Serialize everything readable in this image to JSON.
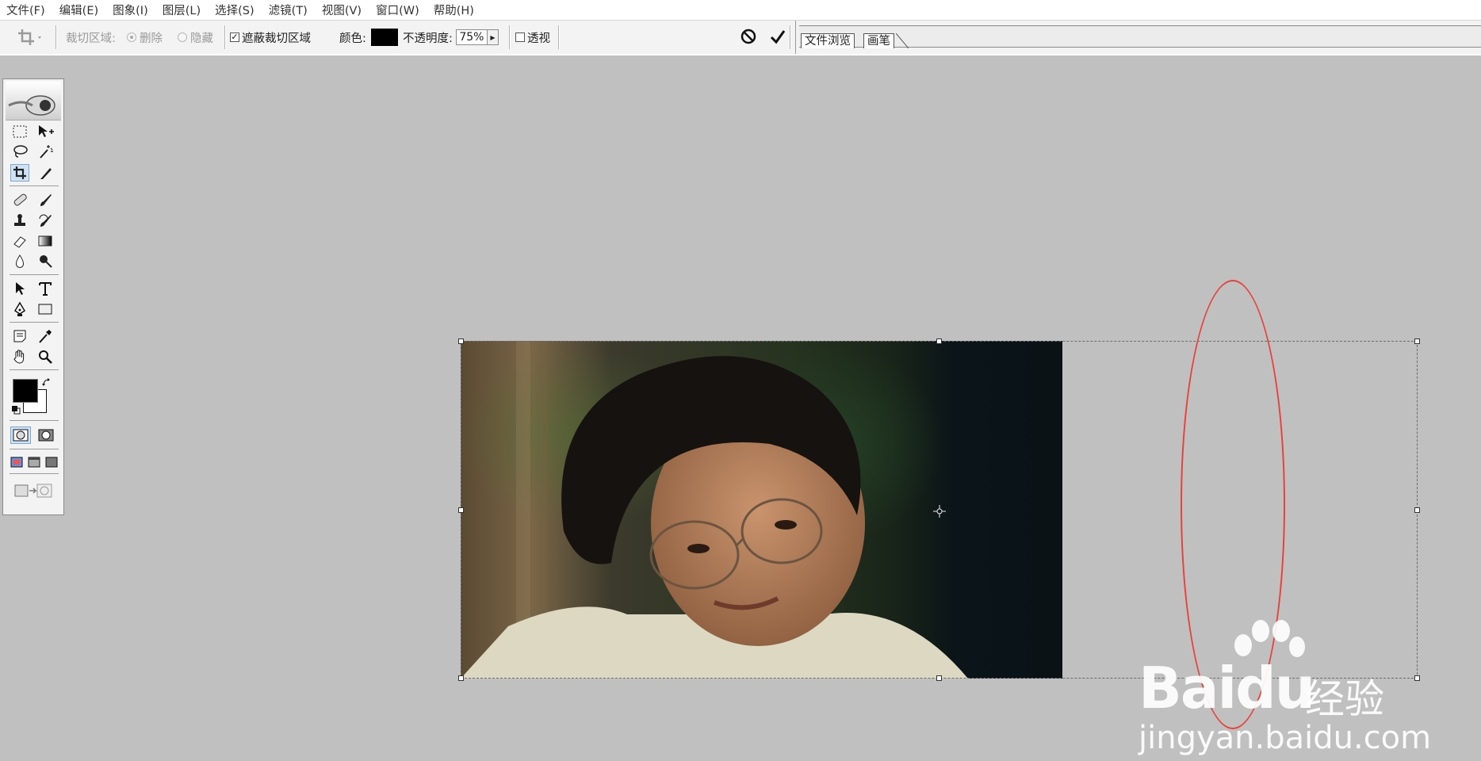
{
  "menubar": {
    "items": [
      "文件(F)",
      "编辑(E)",
      "图象(I)",
      "图层(L)",
      "选择(S)",
      "滤镜(T)",
      "视图(V)",
      "窗口(W)",
      "帮助(H)"
    ]
  },
  "options": {
    "crop_area_label": "裁切区域:",
    "delete_label": "删除",
    "hide_label": "隐藏",
    "shield_label": "遮蔽裁切区域",
    "shield_checked": true,
    "color_label": "颜色:",
    "shield_color": "#000000",
    "opacity_label": "不透明度:",
    "opacity_value": "75%",
    "perspective_label": "透视",
    "perspective_checked": false,
    "cancel_icon": "cancel-circle-icon",
    "commit_icon": "checkmark-icon",
    "tabs": [
      "文件浏览",
      "画笔"
    ]
  },
  "tools": {
    "selected": "crop-tool",
    "foreground_color": "#000000",
    "background_color": "#ffffff"
  },
  "annotation": {
    "color": "#e8403a"
  },
  "watermark": {
    "brand": "Bai",
    "brand_suffix": "du",
    "brand_cn": "经验",
    "url": "jingyan.baidu.com"
  }
}
